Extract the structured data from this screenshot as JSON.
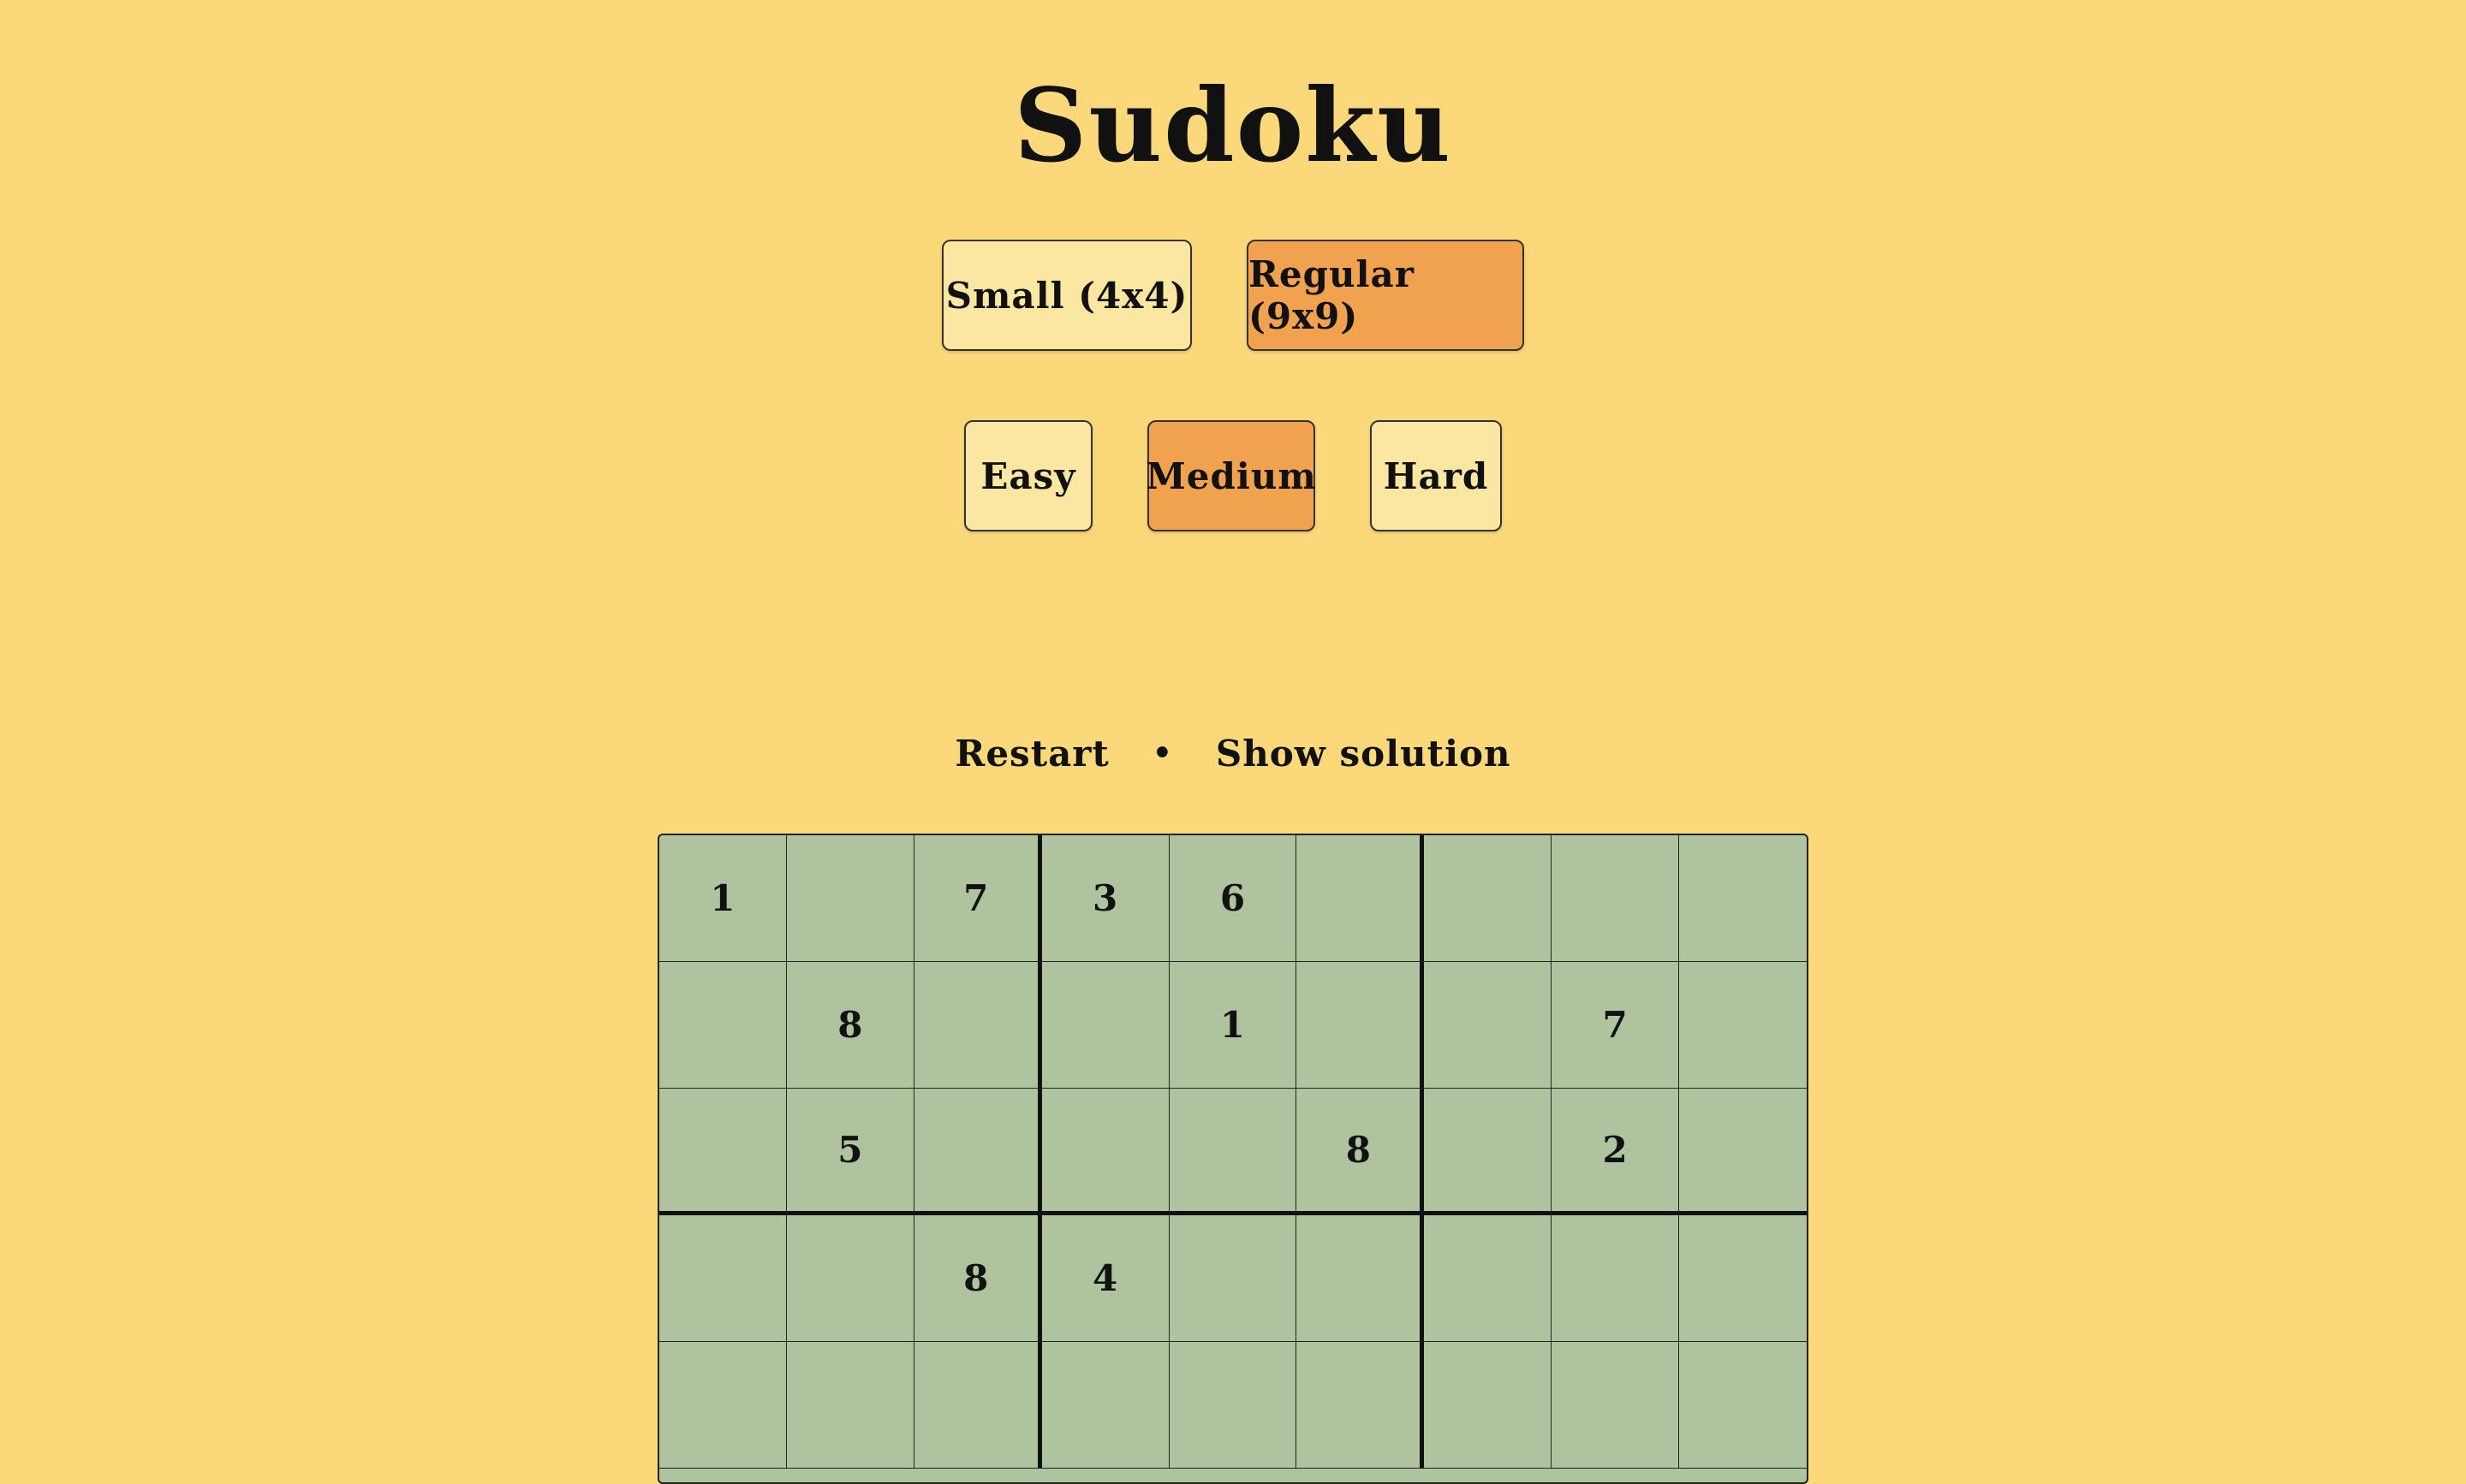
{
  "title": "Sudoku",
  "size_options": [
    {
      "label": "Small (4x4)",
      "active": false
    },
    {
      "label": "Regular (9x9)",
      "active": true
    }
  ],
  "difficulty_options": [
    {
      "label": "Easy",
      "active": false
    },
    {
      "label": "Medium",
      "active": true
    },
    {
      "label": "Hard",
      "active": false
    }
  ],
  "actions": {
    "restart": "Restart",
    "separator": "•",
    "show_solution": "Show solution"
  },
  "grid": {
    "rows": [
      [
        "1",
        "",
        "7",
        "3",
        "6",
        "",
        "",
        "",
        ""
      ],
      [
        "",
        "8",
        "",
        "",
        "1",
        "",
        "",
        "7",
        ""
      ],
      [
        "",
        "5",
        "",
        "",
        "",
        "8",
        "",
        "2",
        ""
      ],
      [
        "",
        "",
        "8",
        "4",
        "",
        "",
        "",
        "",
        ""
      ],
      [
        "",
        "",
        "",
        "",
        "",
        "",
        "",
        "",
        ""
      ]
    ]
  },
  "colors": {
    "background": "#fbd97a",
    "button": "#fce7a2",
    "button_active": "#f0a24f",
    "grid_cell": "#afc39f"
  }
}
